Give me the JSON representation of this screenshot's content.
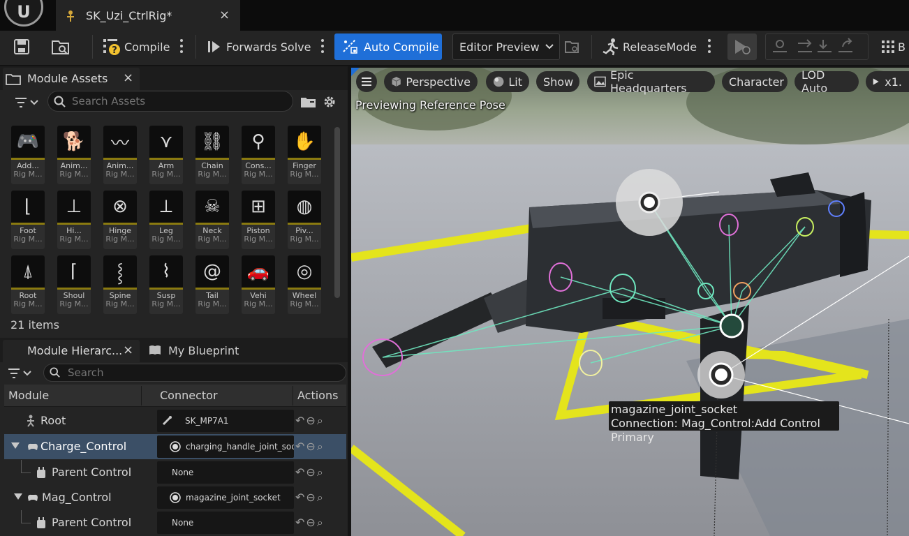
{
  "app": {
    "tab_title": "SK_Uzi_CtrlRig*",
    "close_glyph": "×"
  },
  "toolbar": {
    "compile_label": "Compile",
    "forwards_solve_label": "Forwards Solve",
    "auto_compile_label": "Auto Compile",
    "editor_preview_label": "Editor Preview",
    "release_mode_label": "ReleaseMode",
    "trailing_label": "B"
  },
  "module_assets": {
    "tab_label": "Module Assets",
    "search_placeholder": "Search Assets",
    "item_count": "21 items",
    "items": [
      {
        "name": "Add...",
        "type": "Rig M...",
        "icon": "gamepad-add-icon"
      },
      {
        "name": "Anim...",
        "type": "Rig M...",
        "icon": "animal-icon"
      },
      {
        "name": "Anim...",
        "type": "Rig M...",
        "icon": "animal-tail-icon"
      },
      {
        "name": "Arm",
        "type": "Rig M...",
        "icon": "arm-icon"
      },
      {
        "name": "Chain",
        "type": "Rig M...",
        "icon": "chain-icon"
      },
      {
        "name": "Cons...",
        "type": "Rig M...",
        "icon": "constraint-icon"
      },
      {
        "name": "Finger",
        "type": "Rig M...",
        "icon": "finger-icon"
      },
      {
        "name": "Foot",
        "type": "Rig M...",
        "icon": "foot-icon"
      },
      {
        "name": "Hi...",
        "type": "Rig M...",
        "icon": "hip-icon"
      },
      {
        "name": "Hinge",
        "type": "Rig M...",
        "icon": "hinge-icon"
      },
      {
        "name": "Leg",
        "type": "Rig M...",
        "icon": "leg-icon"
      },
      {
        "name": "Neck",
        "type": "Rig M...",
        "icon": "neck-icon"
      },
      {
        "name": "Piston",
        "type": "Rig M...",
        "icon": "piston-icon"
      },
      {
        "name": "Piv...",
        "type": "Rig M...",
        "icon": "pivot-icon"
      },
      {
        "name": "Root",
        "type": "Rig M...",
        "icon": "root-icon"
      },
      {
        "name": "Shoul",
        "type": "Rig M...",
        "icon": "shoulder-icon"
      },
      {
        "name": "Spine",
        "type": "Rig M...",
        "icon": "spine-icon"
      },
      {
        "name": "Susp",
        "type": "Rig M...",
        "icon": "suspension-icon"
      },
      {
        "name": "Tail",
        "type": "Rig M...",
        "icon": "tail-icon"
      },
      {
        "name": "Vehi",
        "type": "Rig M...",
        "icon": "vehicle-icon"
      },
      {
        "name": "Wheel",
        "type": "Rig M...",
        "icon": "wheel-icon"
      }
    ]
  },
  "hierarchy": {
    "tab_label": "Module Hierarc...",
    "blueprint_tab_label": "My Blueprint",
    "search_placeholder": "Search",
    "columns": {
      "module": "Module",
      "connector": "Connector",
      "actions": "Actions"
    },
    "rows": [
      {
        "module": "Root",
        "connector": "SK_MP7A1"
      },
      {
        "module": "Charge_Control",
        "connector": "charging_handle_joint_socket"
      },
      {
        "module": "Parent Control",
        "connector": "None"
      },
      {
        "module": "Mag_Control",
        "connector": "magazine_joint_socket"
      },
      {
        "module": "Parent Control",
        "connector": "None"
      }
    ]
  },
  "viewport": {
    "perspective_label": "Perspective",
    "lit_label": "Lit",
    "show_label": "Show",
    "environment_label": "Epic Headquarters",
    "character_label": "Character",
    "lod_label": "LOD Auto",
    "speed_label": "x1.",
    "status_text": "Previewing Reference Pose",
    "tooltip_title": "magazine_joint_socket",
    "tooltip_detail": "Connection: Mag_Control:Add Control Primary"
  },
  "colors": {
    "accent_blue": "#1f6fd8",
    "selected_row": "#3b4f66",
    "asset_bar": "#8a7a10",
    "rig_lines": "#6fe8c0",
    "floor_yellow": "#e4e41c"
  }
}
